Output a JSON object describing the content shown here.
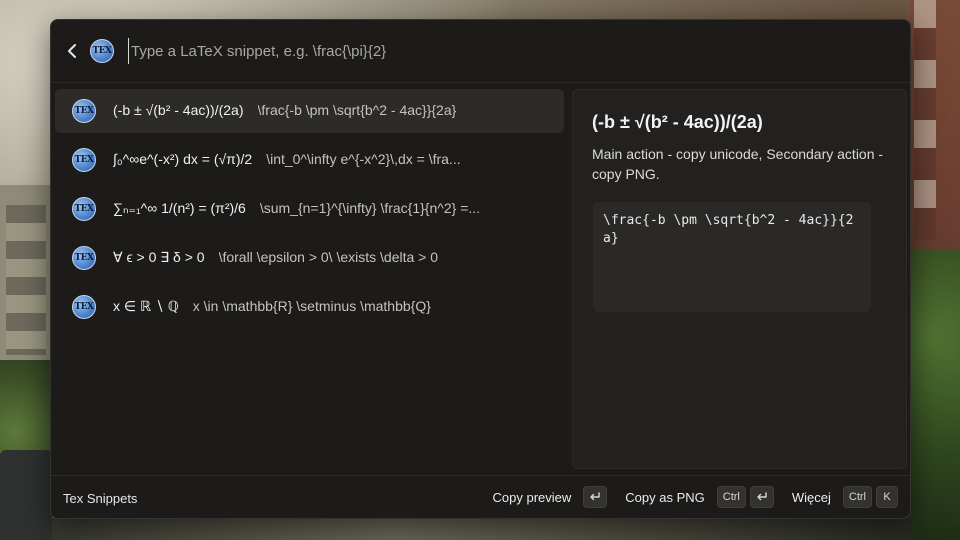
{
  "search": {
    "placeholder": "Type a LaTeX snippet, e.g. \\frac{\\pi}{2}",
    "logo_text": "TEX"
  },
  "results": [
    {
      "title": "(-b ± √(b² - 4ac))/(2a)",
      "latex": "\\frac{-b \\pm \\sqrt{b^2 - 4ac}}{2a}",
      "selected": true
    },
    {
      "title": "∫₀^∞e^(-x²) dx = (√π)/2",
      "latex": "\\int_0^\\infty e^{-x^2}\\,dx = \\fra..."
    },
    {
      "title": "∑ₙ₌₁^∞ 1/(n²) = (π²)/6",
      "latex": "\\sum_{n=1}^{\\infty} \\frac{1}{n^2} =..."
    },
    {
      "title": "∀ ϵ > 0 ∃ δ > 0",
      "latex": "\\forall \\epsilon > 0\\ \\exists \\delta > 0"
    },
    {
      "title": "x ∈ ℝ ∖ ℚ",
      "latex": "x \\in \\mathbb{R} \\setminus \\mathbb{Q}"
    }
  ],
  "detail": {
    "title": "(-b ± √(b² - 4ac))/(2a)",
    "description": "Main action - copy unicode, Secondary action - copy PNG.",
    "code": "\\frac{-b \\pm \\sqrt{b^2 - 4ac}}{2a}"
  },
  "footer": {
    "title": "Tex Snippets",
    "actions": [
      {
        "label": "Copy preview",
        "keys": [
          "enter-icon"
        ]
      },
      {
        "label": "Copy as PNG",
        "keys": [
          "Ctrl",
          "enter-icon"
        ]
      },
      {
        "label": "Więcej",
        "keys": [
          "Ctrl",
          "K"
        ]
      }
    ]
  },
  "icons": {
    "back": "chevron-left-icon",
    "result_icon": "tex-logo-icon"
  }
}
